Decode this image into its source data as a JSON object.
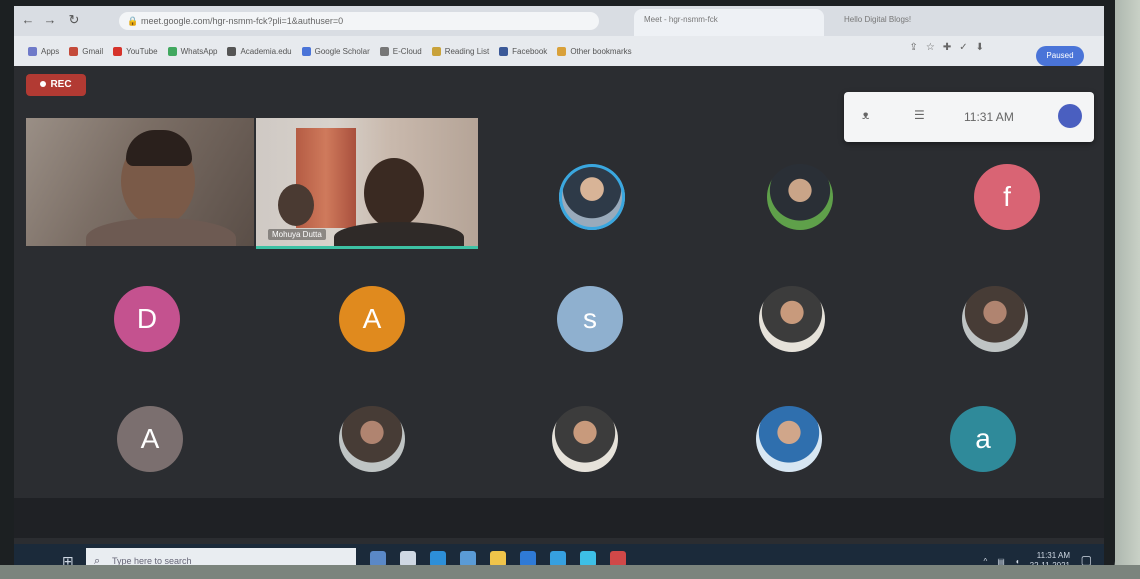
{
  "browser": {
    "url": "meet.google.com/hgr-nsmm-fck?pli=1&authuser=0",
    "active_tab_title": "Meet - hgr-nsmm-fck",
    "second_tab_title": "Hello Digital Blogs!",
    "bookmarks": [
      {
        "label": "Apps",
        "color": "#6f7ac9"
      },
      {
        "label": "Gmail",
        "color": "#c44a3a"
      },
      {
        "label": "YouTube",
        "color": "#d6332b"
      },
      {
        "label": "WhatsApp",
        "color": "#41a85f"
      },
      {
        "label": "Academia.edu",
        "color": "#555555"
      },
      {
        "label": "Google Scholar",
        "color": "#4a74d8"
      },
      {
        "label": "E-Cloud",
        "color": "#777777"
      },
      {
        "label": "Reading List",
        "color": "#c9a23a"
      },
      {
        "label": "Facebook",
        "color": "#3b5998"
      },
      {
        "label": "Other bookmarks",
        "color": "#d9a13a"
      }
    ],
    "profile_label": "Paused"
  },
  "meet": {
    "rec_label": "REC",
    "popup": {
      "time": "11:31 AM"
    },
    "video_tiles": [
      {
        "name": ""
      },
      {
        "name": "Mohuya Dutta"
      }
    ],
    "participants": [
      {
        "type": "photo",
        "style": "photo",
        "ring": true
      },
      {
        "type": "photo",
        "style": "photo-b",
        "ring": false
      },
      {
        "type": "letter",
        "letter": "f",
        "color": "#d96474"
      },
      {
        "type": "letter",
        "letter": "D",
        "color": "#c4528f"
      },
      {
        "type": "letter",
        "letter": "A",
        "color": "#e08a1e"
      },
      {
        "type": "letter",
        "letter": "s",
        "color": "#8fb0cf"
      },
      {
        "type": "photo",
        "style": "photo-c",
        "ring": false
      },
      {
        "type": "photo",
        "style": "photo-d",
        "ring": false
      },
      {
        "type": "letter",
        "letter": "A",
        "color": "#7b6f6f"
      },
      {
        "type": "photo",
        "style": "photo-d",
        "ring": false
      },
      {
        "type": "photo",
        "style": "photo-c",
        "ring": false
      },
      {
        "type": "photo",
        "style": "photo-e",
        "ring": false
      },
      {
        "type": "letter",
        "letter": "a",
        "color": "#2f8a9a"
      }
    ]
  },
  "taskbar": {
    "search_placeholder": "Type here to search",
    "clock_time": "11:31 AM",
    "clock_date": "22-11-2021",
    "icons": [
      "#5a88c6",
      "#cfd8e3",
      "#2d8fd8",
      "#5a9bd6",
      "#f0c44a",
      "#2f7ad6",
      "#36a0e0",
      "#3dbfe6",
      "#d04848"
    ]
  }
}
